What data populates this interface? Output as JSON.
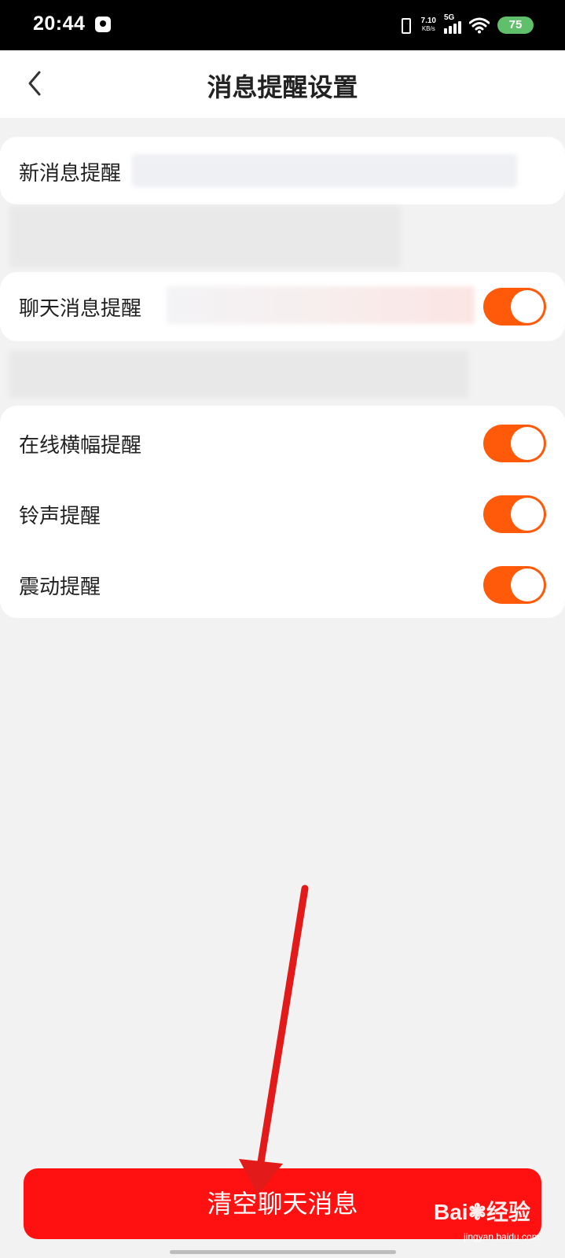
{
  "status_bar": {
    "time": "20:44",
    "speed_value": "7.10",
    "speed_unit": "KB/s",
    "network": "5G",
    "battery": "75",
    "icons": [
      "app-notification-icon",
      "vibrate-icon",
      "signal-icon",
      "wifi-icon",
      "battery-icon"
    ]
  },
  "header": {
    "title": "消息提醒设置",
    "back_icon": "chevron-left-icon"
  },
  "settings": {
    "new_message": {
      "label": "新消息提醒"
    },
    "chat_message": {
      "label": "聊天消息提醒",
      "enabled": true
    },
    "group_alerts": [
      {
        "label": "在线横幅提醒",
        "enabled": true
      },
      {
        "label": "铃声提醒",
        "enabled": true
      },
      {
        "label": "震动提醒",
        "enabled": true
      }
    ]
  },
  "footer": {
    "clear_button_label": "清空聊天消息"
  },
  "watermark": {
    "brand": "Bai",
    "brand_tail": "经验",
    "url": "jingyan.baidu.com"
  },
  "colors": {
    "accent_toggle": "#ff5a0a",
    "clear_button": "#ff1111",
    "background": "#f2f2f2",
    "annotation_arrow": "#e21a1a"
  }
}
